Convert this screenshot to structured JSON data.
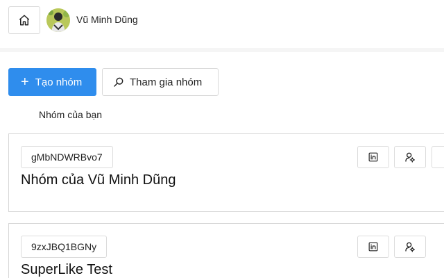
{
  "header": {
    "username": "Vũ Minh Dũng"
  },
  "actions": {
    "create_label": "Tạo nhóm",
    "join_label": "Tham gia nhóm"
  },
  "section": {
    "title": "Nhóm của bạn"
  },
  "groups": [
    {
      "code": "gMbNDWRBvo7",
      "name": "Nhóm của Vũ Minh Dũng"
    },
    {
      "code": "9zxJBQ1BGNy",
      "name": "SuperLike Test"
    }
  ],
  "colors": {
    "primary": "#2f8ded",
    "border": "#d9d9d9"
  },
  "icons": {
    "home": "home-icon",
    "search": "search-icon",
    "linkedin": "linkedin-icon",
    "user_settings": "user-settings-icon"
  }
}
